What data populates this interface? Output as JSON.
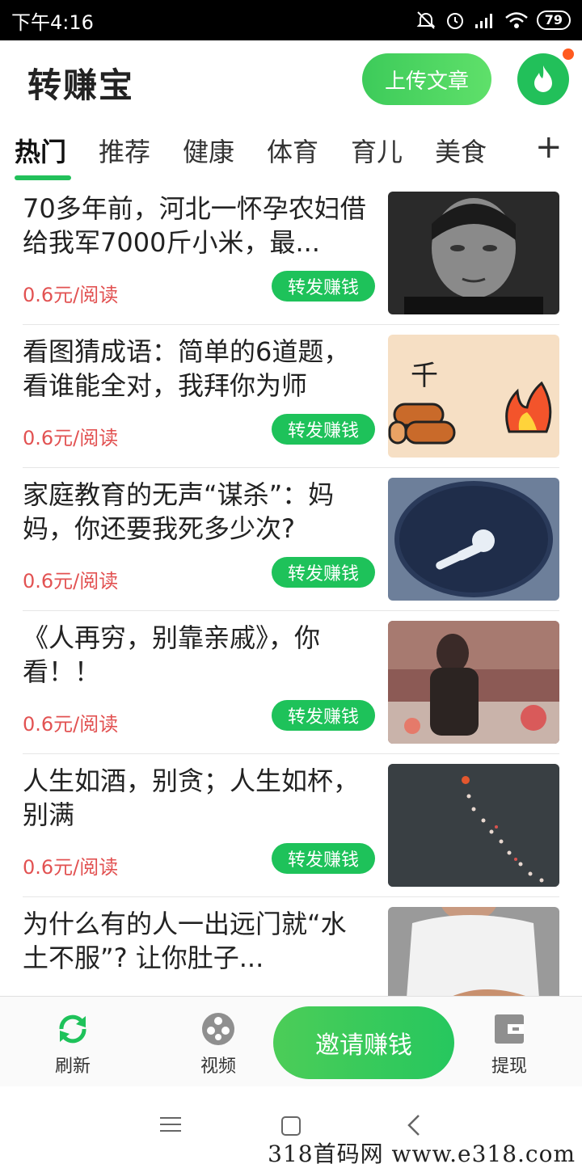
{
  "status_bar": {
    "time": "下午4:16",
    "battery": "79"
  },
  "header": {
    "title": "转赚宝",
    "upload_label": "上传文章"
  },
  "tabs": [
    {
      "label": "热门",
      "active": true
    },
    {
      "label": "推荐"
    },
    {
      "label": "健康"
    },
    {
      "label": "体育"
    },
    {
      "label": "育儿"
    },
    {
      "label": "美食"
    }
  ],
  "tabs_more": "+",
  "articles": [
    {
      "title": "70多年前，河北一怀孕农妇借给我军7000斤小米，最...",
      "price": "0.6元/阅读",
      "share": "转发赚钱"
    },
    {
      "title": "看图猜成语：简单的6道题，看谁能全对，我拜你为师",
      "price": "0.6元/阅读",
      "share": "转发赚钱"
    },
    {
      "title": "家庭教育的无声“谋杀”：妈妈，你还要我死多少次?",
      "price": "0.6元/阅读",
      "share": "转发赚钱"
    },
    {
      "title": "《人再穷，别靠亲戚》，你看！！",
      "price": "0.6元/阅读",
      "share": "转发赚钱"
    },
    {
      "title": "人生如酒，别贪；人生如杯，别满",
      "price": "0.6元/阅读",
      "share": "转发赚钱"
    },
    {
      "title": "为什么有的人一出远门就“水土不服”? 让你肚子...",
      "price": "",
      "share": ""
    }
  ],
  "thumb_text": "千",
  "bottom_nav": {
    "refresh": "刷新",
    "video": "视频",
    "invite": "邀请赚钱",
    "withdraw": "提现"
  },
  "watermark": "318首码网  www.e318.com",
  "colors": {
    "accent": "#22c05a",
    "price": "#e25252"
  }
}
